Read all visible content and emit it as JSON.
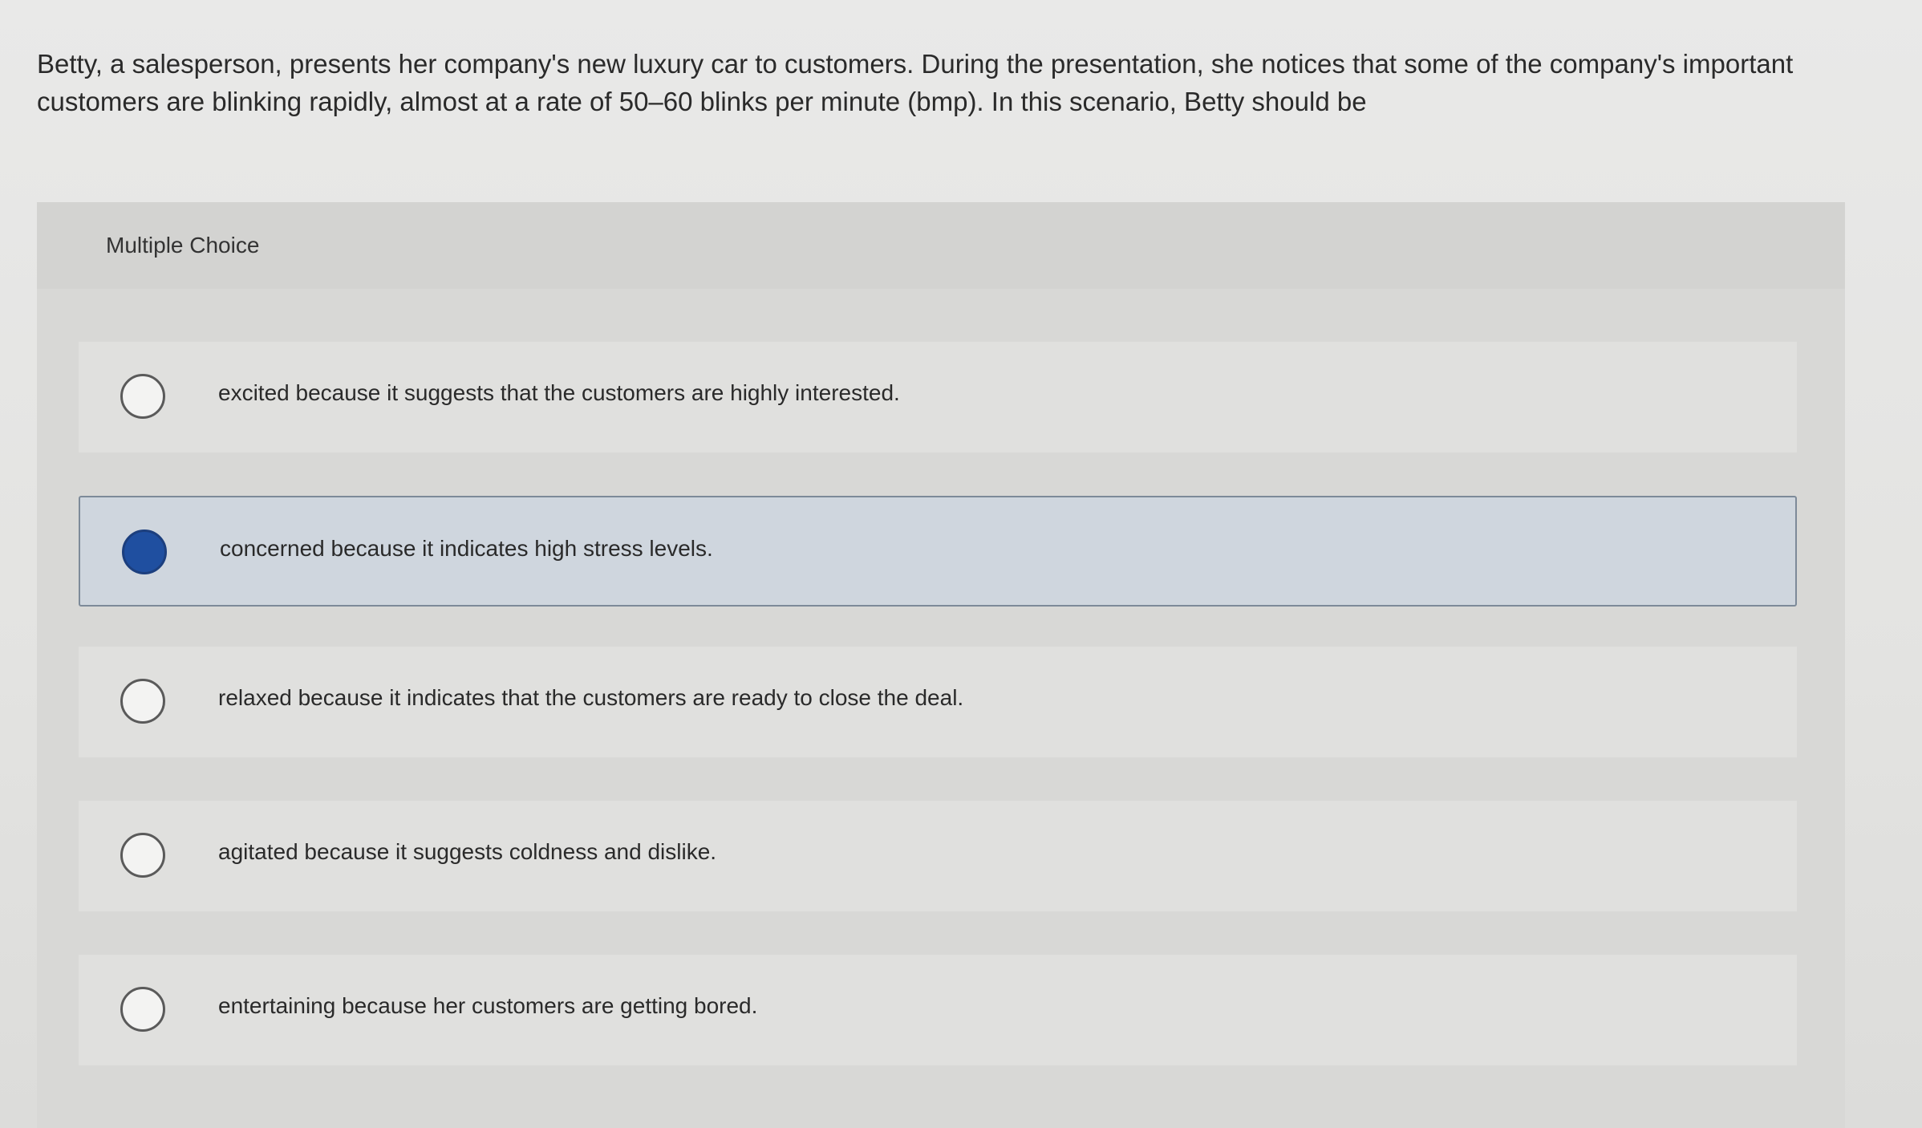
{
  "question": {
    "text": "Betty, a salesperson, presents her company's new luxury car to customers. During the presentation, she notices that some of the company's important customers are blinking rapidly, almost at a rate of 50–60 blinks per minute (bmp). In this scenario, Betty should be"
  },
  "panel": {
    "title": "Multiple Choice"
  },
  "options": [
    {
      "label": "excited because it suggests that the customers are highly interested.",
      "selected": false
    },
    {
      "label": "concerned because it indicates high stress levels.",
      "selected": true
    },
    {
      "label": "relaxed because it indicates that the customers are ready to close the deal.",
      "selected": false
    },
    {
      "label": "agitated because it suggests coldness and dislike.",
      "selected": false
    },
    {
      "label": "entertaining because her customers are getting bored.",
      "selected": false
    }
  ],
  "colors": {
    "selected_radio": "#1f4fa0",
    "selected_background": "#cfd6de",
    "selected_border": "#7d8a99"
  }
}
